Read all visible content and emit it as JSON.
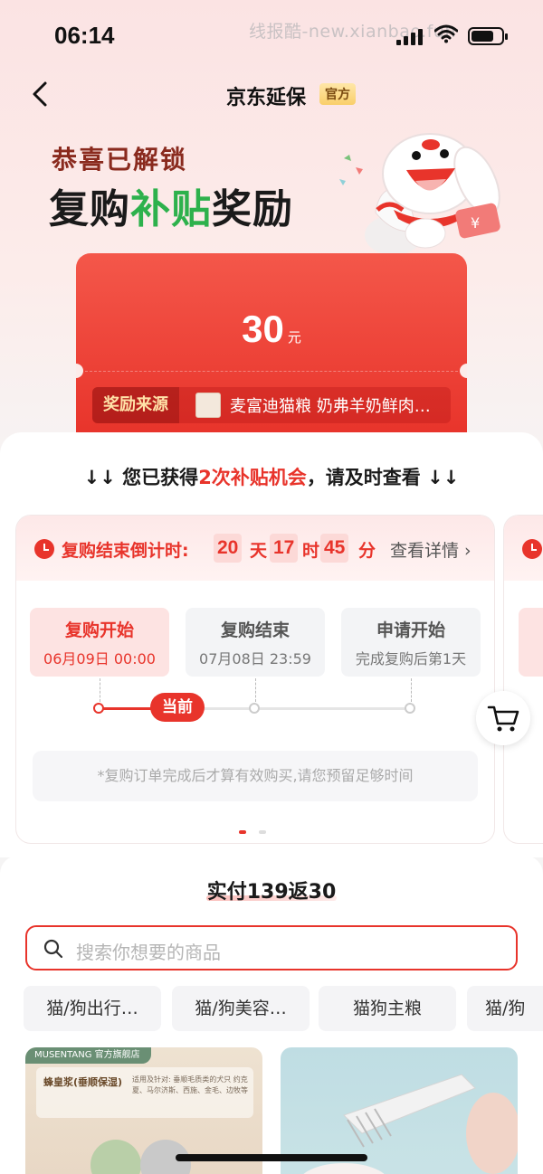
{
  "status": {
    "time": "06:14",
    "watermark": "线报酷-new.xianbao.fun"
  },
  "nav": {
    "title": "京东延保",
    "badge": "官方"
  },
  "hero": {
    "unlock": "恭喜已解锁",
    "title_part1": "复购",
    "title_green": "补贴",
    "title_part2": "奖励"
  },
  "coupon": {
    "amount": "30",
    "unit": "元",
    "source_tag": "奖励来源",
    "source_text": "麦富迪猫粮 奶弗羊奶鲜肉…"
  },
  "chances": {
    "prefix": "↓↓ 您已获得",
    "highlight": "2次补贴机会",
    "suffix": "，请及时查看 ↓↓"
  },
  "countdown": {
    "label": "复购结束倒计时:",
    "days": "20",
    "days_unit": "天",
    "hours": "17",
    "hours_unit": "时",
    "minutes": "45",
    "minutes_unit": "分",
    "detail": "查看详情 ›"
  },
  "steps": [
    {
      "title": "复购开始",
      "date": "06月09日 00:00"
    },
    {
      "title": "复购结束",
      "date": "07月08日 23:59"
    },
    {
      "title": "申请开始",
      "date": "完成复购后第1天"
    }
  ],
  "timeline": {
    "current": "当前"
  },
  "note": "*复购订单完成后才算有效购买,请您预留足够时间",
  "lower": {
    "paid_title": "实付139返30",
    "search_placeholder": "搜索你想要的商品",
    "chips": [
      "猫/狗出行…",
      "猫/狗美容…",
      "猫狗主粮",
      "猫/狗"
    ]
  },
  "products": {
    "p1_brand": "MUSENTANG 官方旗舰店",
    "p1_name": "蜂皇浆(垂顺保湿)",
    "p1_desc": "适用及针对: 垂顺毛质类的犬只 约克夏、马尔济斯、西施、金毛、边牧等"
  },
  "colors": {
    "accent": "#e8342b",
    "green": "#2db14c"
  }
}
